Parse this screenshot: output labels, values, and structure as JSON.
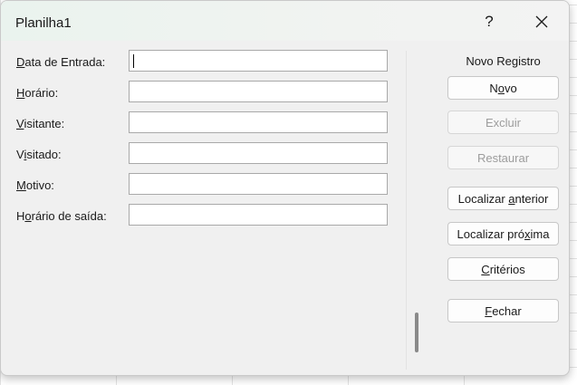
{
  "dialog": {
    "title": "Planilha1",
    "help_label": "?",
    "close_icon": "close-icon"
  },
  "fields": [
    {
      "label_pre": "",
      "label_key": "D",
      "label_post": "ata de Entrada:",
      "value": ""
    },
    {
      "label_pre": "",
      "label_key": "H",
      "label_post": "orário:",
      "value": ""
    },
    {
      "label_pre": "",
      "label_key": "V",
      "label_post": "isitante:",
      "value": ""
    },
    {
      "label_pre": "V",
      "label_key": "i",
      "label_post": "sitado:",
      "value": ""
    },
    {
      "label_pre": "",
      "label_key": "M",
      "label_post": "otivo:",
      "value": ""
    },
    {
      "label_pre": "H",
      "label_key": "o",
      "label_post": "rário de saída:",
      "value": ""
    }
  ],
  "record_status": "Novo Registro",
  "buttons": [
    {
      "pre": "N",
      "key": "o",
      "post": "vo",
      "enabled": true
    },
    {
      "pre": "Exc",
      "key": "l",
      "post": "uir",
      "enabled": false
    },
    {
      "pre": "",
      "key": "R",
      "post": "estaurar",
      "enabled": false
    },
    {
      "pre": "Localizar ",
      "key": "a",
      "post": "nterior",
      "enabled": true
    },
    {
      "pre": "Localizar pró",
      "key": "x",
      "post": "ima",
      "enabled": true
    },
    {
      "pre": "",
      "key": "C",
      "post": "ritérios",
      "enabled": true
    },
    {
      "pre": "",
      "key": "F",
      "post": "echar",
      "enabled": true
    }
  ]
}
